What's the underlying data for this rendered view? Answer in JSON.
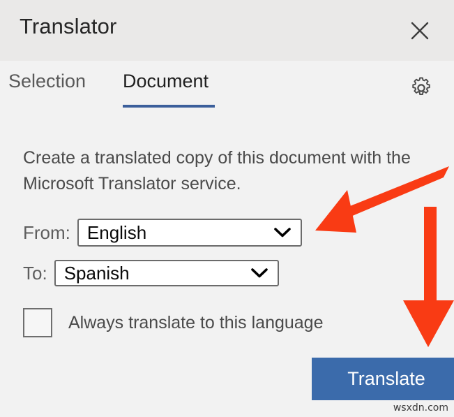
{
  "window": {
    "title": "Translator",
    "close_icon": "close-icon"
  },
  "tabs": [
    {
      "label": "Selection",
      "selected": false
    },
    {
      "label": "Document",
      "selected": true
    }
  ],
  "settings": {
    "icon": "gear-icon"
  },
  "main": {
    "description": "Create a translated copy of this document with the Microsoft Translator service.",
    "from": {
      "label": "From:",
      "value": "English",
      "caret_icon": "chevron-down-icon"
    },
    "to": {
      "label": "To:",
      "value": "Spanish",
      "caret_icon": "chevron-down-icon"
    },
    "always_translate": {
      "label": "Always translate to this language",
      "checked": false
    },
    "translate_button": "Translate"
  },
  "annotations": {
    "arrow_color": "#f93b14",
    "arrows": [
      {
        "name": "arrow-to-from-dropdown",
        "direction": "down-left"
      },
      {
        "name": "arrow-to-translate-button",
        "direction": "down"
      }
    ]
  },
  "watermark": "wsxdn.com",
  "colors": {
    "header_bg": "#eae9e8",
    "body_bg": "#f2f2f2",
    "accent": "#3b5f9b",
    "button_bg": "#3b6bab",
    "arrow": "#f93b14"
  }
}
